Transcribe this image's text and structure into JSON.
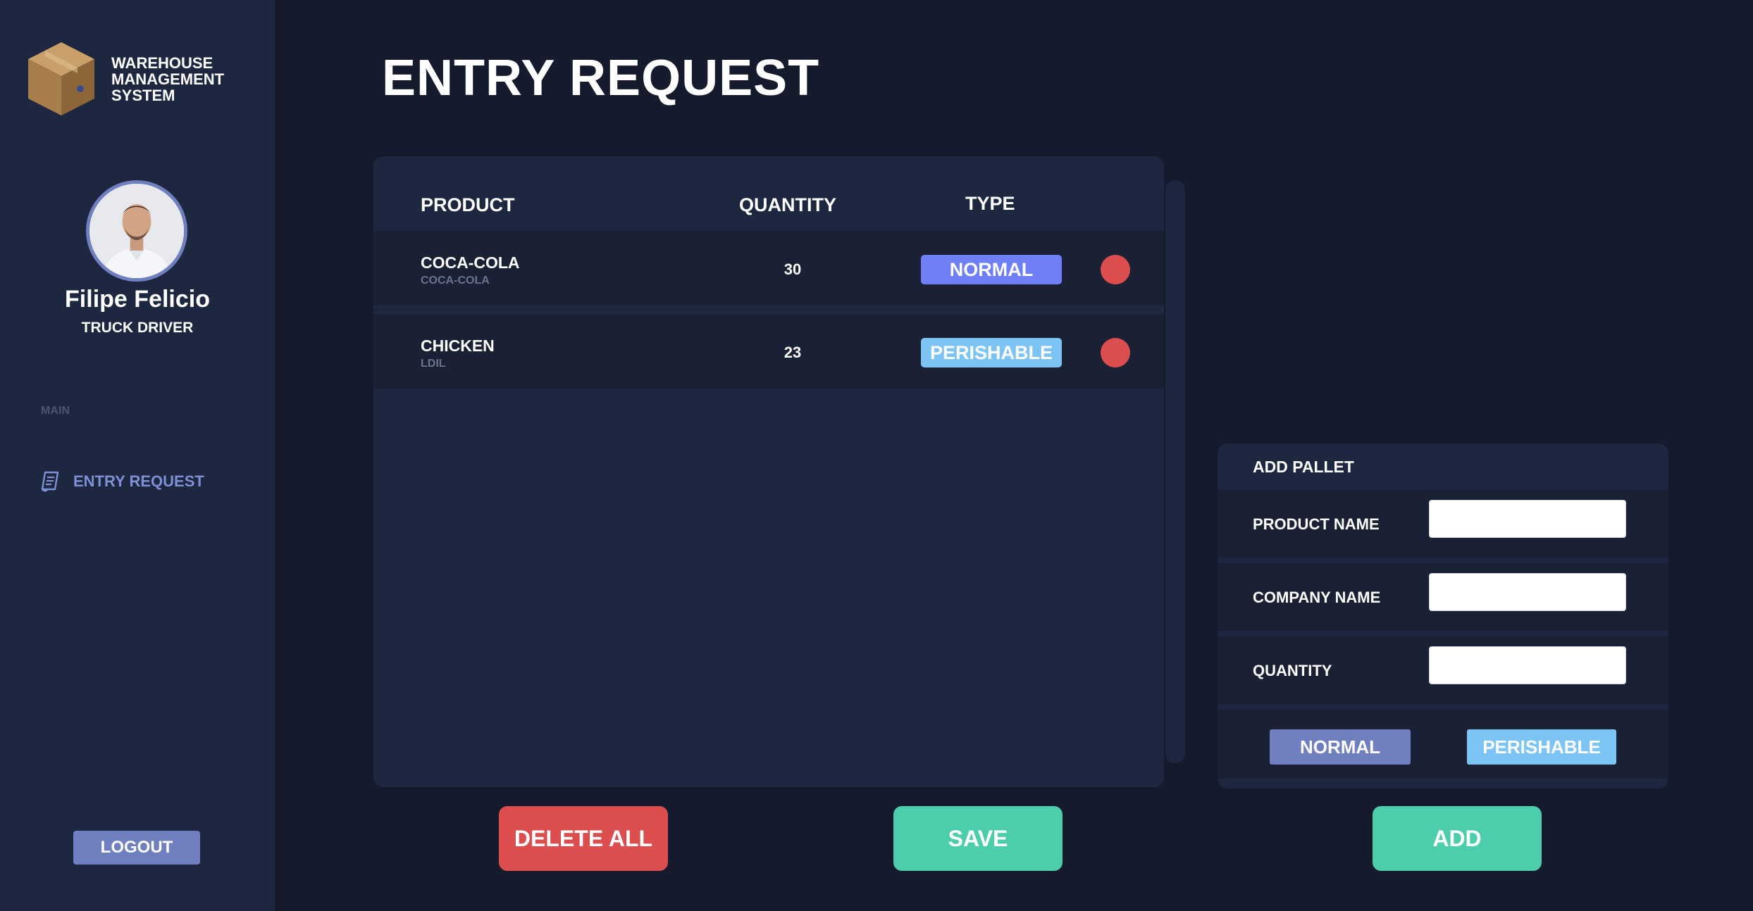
{
  "app": {
    "brand_title": "WAREHOUSE MANAGEMENT SYSTEM"
  },
  "user": {
    "name": "Filipe Felicio",
    "role": "TRUCK DRIVER"
  },
  "sidebar": {
    "section_label": "MAIN",
    "items": [
      {
        "label": "ENTRY REQUEST",
        "icon": "receipt-icon"
      }
    ],
    "logout_label": "LOGOUT"
  },
  "page": {
    "title": "ENTRY REQUEST"
  },
  "table": {
    "columns": [
      "PRODUCT",
      "QUANTITY",
      "TYPE"
    ],
    "rows": [
      {
        "product": "COCA-COLA",
        "company": "COCA-COLA",
        "quantity": "30",
        "type": "NORMAL"
      },
      {
        "product": "CHICKEN",
        "company": "LDIL",
        "quantity": "23",
        "type": "PERISHABLE"
      }
    ]
  },
  "actions": {
    "delete_all_label": "DELETE ALL",
    "save_label": "SAVE",
    "add_label": "ADD"
  },
  "form": {
    "title": "ADD PALLET",
    "product_name_label": "PRODUCT NAME",
    "product_name_value": "",
    "company_name_label": "COMPANY NAME",
    "company_name_value": "",
    "quantity_label": "QUANTITY",
    "quantity_value": "",
    "type_normal_label": "NORMAL",
    "type_perishable_label": "PERISHABLE"
  },
  "colors": {
    "background": "#151b2c",
    "panel": "#1e2740",
    "accent": "#6f7fc0",
    "normal_badge": "#6f7ff5",
    "perishable_badge": "#7cc4f5",
    "danger": "#dc4e4e",
    "success": "#4ccdac"
  }
}
